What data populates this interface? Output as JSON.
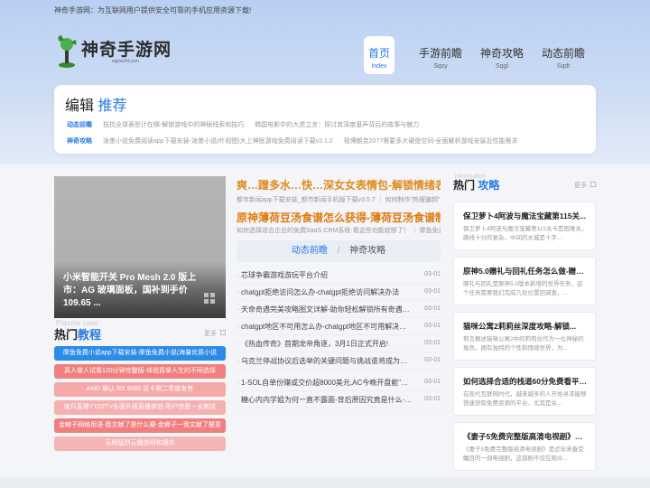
{
  "notice": "神奇手游网：为互联网用户提供安全可靠的手机应用资源下载!",
  "logo": {
    "text": "神奇手游网",
    "sub": "sqjswzhl.com"
  },
  "nav": [
    {
      "t": "首页",
      "s": "Index"
    },
    {
      "t": "手游前瞻",
      "s": "Sqsy"
    },
    {
      "t": "神奇攻略",
      "s": "Sqgl"
    },
    {
      "t": "动态前瞻",
      "s": "Sqdt"
    }
  ],
  "recommend": {
    "title_a": "编辑",
    "title_b": "推荐",
    "rows": [
      {
        "k": "动态前瞻",
        "items": [
          "抵抗全球表型计在哪-解锁游戏中的神秘线索和技巧",
          "韩国电影中的大虎之言：探讨其深度基声背后的故事与魅力"
        ]
      },
      {
        "k": "神奇攻略",
        "items": [
          "泼墨小说免费阅读app下载安装-泼墨小说(叶视图)大上神医游戏免费阅读下载v2.1.2",
          "视博朗克2077需要多大硬盘空间-全面解析游戏安装及性能需求"
        ]
      }
    ]
  },
  "slide": {
    "caption": "小米智能开关 Pro Mesh 2.0 版上市：AG 玻璃面板，国补到手价 109.65 ..."
  },
  "hot_tutorial": {
    "bg": "Popular case",
    "title_a": "热门",
    "title_b": "教程",
    "more": "更多",
    "buttons": [
      {
        "label": "摩鱼免费小说app下载安装-摩鱼免费小说(海量优质小说",
        "color": "#2b8be8"
      },
      {
        "label": "真人做人试看120分钟完整版-体验真挚人生的不同选择",
        "color": "#f08080"
      },
      {
        "label": "AMD 确认 RX 9060 显卡第二季度发售",
        "color": "#f4a9a9"
      },
      {
        "label": "夜月直播YY22TV全面升级直播体验-用户惊愿一全新技",
        "color": "#f5b0b0"
      },
      {
        "label": "金蝉子网络用语-我文献了是什么梗-金蝉子一我文献了梗意",
        "color": "#f08080"
      },
      {
        "label": "无眼猛烈云播放网和播件",
        "color": "#f6b5b5"
      }
    ]
  },
  "middle": {
    "h1": "爽…蹭多水…快…深女女表情包-解锁情绪表...",
    "sub1": "都市新闻app下载安装_都市新闻手机版下载v3.5.7 ｜ 如何制作“热搜骗钥”",
    "h2": "原神薄荷豆汤食谱怎么获得-薄荷豆汤食谱制...",
    "sub2": "如何选择适合企业的免费SaaS·CRM系统·看这些功能就够了！ ｜ 摩鱼免费",
    "tab_on": "动态前瞻",
    "tab_off": "神奇攻略",
    "items": [
      {
        "text": "芯球争霸游戏游玩平台介绍",
        "date": "03-01"
      },
      {
        "text": "chatgpt拒绝访问怎么办-chatgpt拒绝访问解决办法",
        "date": "03-01"
      },
      {
        "text": "天命奇遇完美攻略图文详解-助你轻松解锁所有奇遇任...",
        "date": "03-01"
      },
      {
        "text": "chatgpt地区不可用怎么办-chatgpt地区不可用解决办法",
        "date": "03-01"
      },
      {
        "text": "《热血传奇》首期龙帝角逐，3月1日正式开启!",
        "date": "03-01"
      },
      {
        "text": "乌克兰停战协议后选举的关键问题与挑战谁将成为新...",
        "date": "03-01"
      },
      {
        "text": "1-SOL自单份赚或交价超8000美元,AC今晚开盘能\"无...",
        "date": "03-01"
      },
      {
        "text": "糖心内内学姐为何一直不露面-背后原因究竟是什么-引...",
        "date": "03-01"
      }
    ]
  },
  "hot_guide": {
    "bg": "information",
    "title_a": "热门",
    "title_b": "攻略",
    "more": "更多",
    "cards": [
      {
        "title": "保卫萝卜4阿波与魔法宝藏第115关...",
        "desc": "保卫萝卜4阿波与魔法宝藏第115关卡是困难关，路线十分的复杂，中间的水城是十字..."
      },
      {
        "title": "原神5.0赠礼与回礼任务怎么做-赠礼...",
        "desc": "赠礼与回礼是原神5.0版本新增的世界任务，这个任务需要我们完成几处位置回调查，..."
      },
      {
        "title": "猫咪公寓2莉莉丝深度攻略-解锁...",
        "desc": "莉言概述猫咪公寓2中的莉莉丝作为一位神秘的角色，拥有独特的个性和情感世界，为..."
      },
      {
        "title": "如何选择合适的栈道60分免费看平台...",
        "desc": "在现代互联网时代，越来越多的人开始寻求能够快速获取免费资源的平台，尤其是关..."
      },
      {
        "title": "《妻子5免费完整版高清电视剧》如...",
        "desc": "《妻子5免费完整版高清电视剧》是近年来备受瞩目的一部电视剧，这部剧不仅在观众..."
      }
    ]
  }
}
